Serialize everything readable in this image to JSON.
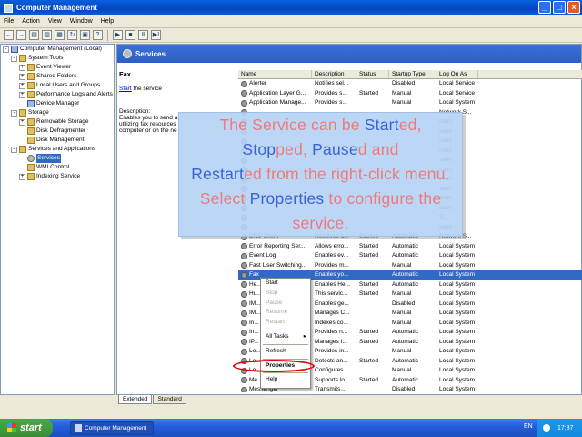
{
  "window": {
    "title": "Computer Management"
  },
  "menu": [
    "File",
    "Action",
    "View",
    "Window",
    "Help"
  ],
  "toolbar_icons": [
    "back-icon",
    "forward-icon",
    "up-icon",
    "show-hide-tree-icon",
    "properties-icon",
    "refresh-icon",
    "export-icon",
    "help-icon",
    "play-icon",
    "stop-icon",
    "pause-icon",
    "restart-icon"
  ],
  "tree": [
    {
      "label": "Computer Management (Local)",
      "level": 0,
      "exp": "-",
      "icon": "comp"
    },
    {
      "label": "System Tools",
      "level": 1,
      "exp": "-",
      "icon": "tool"
    },
    {
      "label": "Event Viewer",
      "level": 2,
      "exp": "+",
      "icon": "tool"
    },
    {
      "label": "Shared Folders",
      "level": 2,
      "exp": "+",
      "icon": "tool"
    },
    {
      "label": "Local Users and Groups",
      "level": 2,
      "exp": "+",
      "icon": "tool"
    },
    {
      "label": "Performance Logs and Alerts",
      "level": 2,
      "exp": "+",
      "icon": "tool"
    },
    {
      "label": "Device Manager",
      "level": 2,
      "exp": "",
      "icon": "comp"
    },
    {
      "label": "Storage",
      "level": 1,
      "exp": "-",
      "icon": "tool"
    },
    {
      "label": "Removable Storage",
      "level": 2,
      "exp": "+",
      "icon": "tool"
    },
    {
      "label": "Disk Defragmenter",
      "level": 2,
      "exp": "",
      "icon": "tool"
    },
    {
      "label": "Disk Management",
      "level": 2,
      "exp": "",
      "icon": "tool"
    },
    {
      "label": "Services and Applications",
      "level": 1,
      "exp": "-",
      "icon": "tool"
    },
    {
      "label": "Services",
      "level": 2,
      "exp": "",
      "icon": "gear",
      "selected": true
    },
    {
      "label": "WMI Control",
      "level": 2,
      "exp": "",
      "icon": "tool"
    },
    {
      "label": "Indexing Service",
      "level": 2,
      "exp": "+",
      "icon": "tool"
    }
  ],
  "services_header": "Services",
  "detail": {
    "title": "Fax",
    "start_link": "Start",
    "start_rest": " the service",
    "description_label": "Description:",
    "description_lines": [
      "Enables you to send a",
      "utilizing fax resources",
      "computer or on the ne"
    ]
  },
  "columns": [
    "Name",
    "Description",
    "Status",
    "Startup Type",
    "Log On As"
  ],
  "rows": [
    [
      "Alerter",
      "Notifies sel...",
      "",
      "Disabled",
      "Local Service"
    ],
    [
      "Application Layer G...",
      "Provides s...",
      "Started",
      "Manual",
      "Local Service"
    ],
    [
      "Application Manage...",
      "Provides s...",
      "",
      "Manual",
      "Local System"
    ],
    [
      "",
      "",
      "",
      "",
      "Network S..."
    ],
    [
      "",
      "",
      "",
      "",
      "stem"
    ],
    [
      "",
      "",
      "",
      "",
      "stem"
    ],
    [
      "",
      "",
      "",
      "",
      "stem"
    ],
    [
      "",
      "",
      "",
      "",
      "stem"
    ],
    [
      "",
      "",
      "",
      "",
      "stem"
    ],
    [
      "",
      "",
      "",
      "",
      "stem"
    ],
    [
      "",
      "",
      "",
      "",
      "stem"
    ],
    [
      "",
      "",
      "",
      "",
      "stem"
    ],
    [
      "",
      "",
      "",
      "",
      "stem"
    ],
    [
      "",
      "",
      "",
      "",
      "stem"
    ],
    [
      "",
      "",
      "",
      "",
      "S..."
    ],
    [
      "",
      "",
      "",
      "",
      "stem"
    ],
    [
      "DNS Client",
      "Resolves a...",
      "Started",
      "Automatic",
      "Network S..."
    ],
    [
      "Error Reporting Ser...",
      "Allows erro...",
      "Started",
      "Automatic",
      "Local System"
    ],
    [
      "Event Log",
      "Enables ev...",
      "Started",
      "Automatic",
      "Local System"
    ],
    [
      "Fast User Switching...",
      "Provides m...",
      "",
      "Manual",
      "Local System"
    ],
    [
      "Fax",
      "Enables yo...",
      "",
      "Automatic",
      "Local System"
    ],
    [
      "He...",
      "Enables He...",
      "Started",
      "Automatic",
      "Local System"
    ],
    [
      "Hu...",
      "This servic...",
      "Started",
      "Manual",
      "Local System"
    ],
    [
      "IM...",
      "Enables ge...",
      "",
      "Disabled",
      "Local System"
    ],
    [
      "IM...",
      "Manages C...",
      "",
      "Manual",
      "Local System"
    ],
    [
      "In...",
      "Indexes co...",
      "",
      "Manual",
      "Local System"
    ],
    [
      "In...",
      "Provides n...",
      "Started",
      "Automatic",
      "Local System"
    ],
    [
      "IP...",
      "Manages I...",
      "Started",
      "Automatic",
      "Local System"
    ],
    [
      "Lo...",
      "Provides in...",
      "",
      "Manual",
      "Local System"
    ],
    [
      "Lo...",
      "Detects an...",
      "Started",
      "Automatic",
      "Local System"
    ],
    [
      "Lo...",
      "Configures...",
      "",
      "Manual",
      "Local System"
    ],
    [
      "Me...",
      "Supports lo...",
      "Started",
      "Automatic",
      "Local System"
    ],
    [
      "Messenger",
      "Transmits...",
      "",
      "Disabled",
      "Local System"
    ]
  ],
  "selected_row": 20,
  "context_menu": {
    "start": "Start",
    "stop": "Stop",
    "pause": "Pause",
    "resume": "Resume",
    "restart": "Restart",
    "all_tasks": "All Tasks",
    "refresh": "Refresh",
    "properties": "Properties",
    "help": "Help"
  },
  "tabs": {
    "extended": "Extended",
    "standard": "Standard"
  },
  "callout": {
    "t1": "The Service can be ",
    "t2": "Start",
    "t3": "ed, ",
    "t4": "Stop",
    "t5": "ped, ",
    "t6": "Pause",
    "t7": "d and ",
    "t8": "Restart",
    "t9": "ed from the right-click menu. Select ",
    "t10": "Properties",
    "t11": " to configure the service."
  },
  "taskbar": {
    "start": "start",
    "task": "Computer Management",
    "lang": "EN",
    "clock": "17:37"
  },
  "colors": {
    "accent": "#316ac5",
    "title_blue": "#0a5fdc",
    "highlight_ring": "#e00000",
    "callout_text": "#f07a7a",
    "callout_highlight": "#3a62d8"
  }
}
